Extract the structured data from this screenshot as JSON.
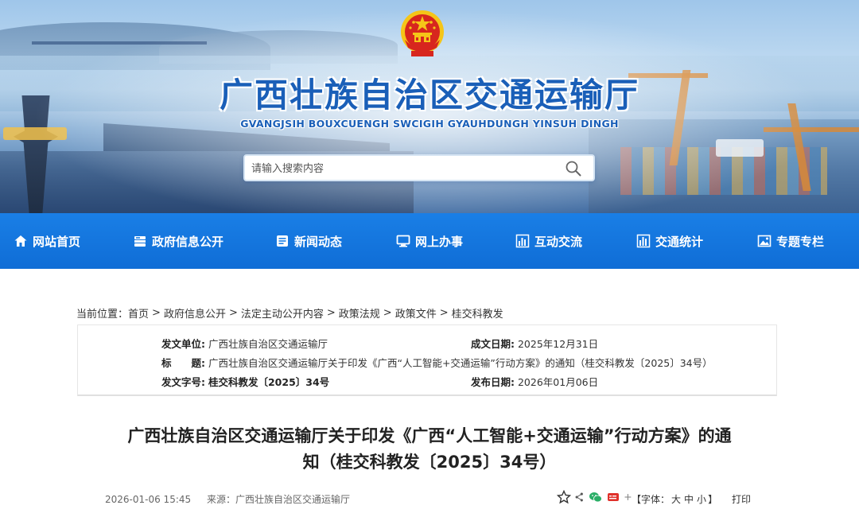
{
  "header": {
    "site_title": "广西壮族自治区交通运输厅",
    "site_subtitle": "GVANGJSIH BOUXCUENGH SWCIGIH GYAUHDUNGH YINSUH DINGH"
  },
  "search": {
    "placeholder": "请输入搜索内容",
    "value": ""
  },
  "nav": {
    "items": [
      {
        "label": "网站首页",
        "icon": "home-icon"
      },
      {
        "label": "政府信息公开",
        "icon": "government-icon"
      },
      {
        "label": "新闻动态",
        "icon": "news-icon"
      },
      {
        "label": "网上办事",
        "icon": "computer-icon"
      },
      {
        "label": "互动交流",
        "icon": "chart-icon"
      },
      {
        "label": "交通统计",
        "icon": "statistics-icon"
      },
      {
        "label": "专题专栏",
        "icon": "image-icon"
      }
    ]
  },
  "breadcrumb": {
    "prefix": "当前位置：",
    "items": [
      "首页",
      "政府信息公开",
      "法定主动公开内容",
      "政策法规",
      "政策文件",
      "桂交科教发"
    ],
    "separator": ">"
  },
  "meta": {
    "issuer_label": "发文单位:",
    "issuer": "广西壮族自治区交通运输厅",
    "date_label": "成文日期:",
    "date": "2025年12月31日",
    "title_label": "标　　题:",
    "title": "广西壮族自治区交通运输厅关于印发《广西“人工智能+交通运输”行动方案》的通知（桂交科教发〔2025〕34号）",
    "docno_label": "发文字号:",
    "docno": "桂交科教发〔2025〕34号",
    "publish_label": "发布日期:",
    "publish": "2026年01月06日"
  },
  "article": {
    "title_line1": "广西壮族自治区交通运输厅关于印发《广西“人工智能+交通运输”行动方案》的通",
    "title_line2": "知（桂交科教发〔2025〕34号）",
    "datetime": "2026-01-06 15:45",
    "source": "来源：广西壮族自治区交通运输厅",
    "font_label_open": "【字体：",
    "font_large": "大",
    "font_medium": "中",
    "font_small": "小",
    "font_label_close": "】",
    "print": "打印"
  },
  "colors": {
    "nav_bg": "#1a7fe6",
    "title_blue": "#1a5fb8",
    "emblem_red": "#d7261e",
    "emblem_gold": "#f5c518"
  }
}
